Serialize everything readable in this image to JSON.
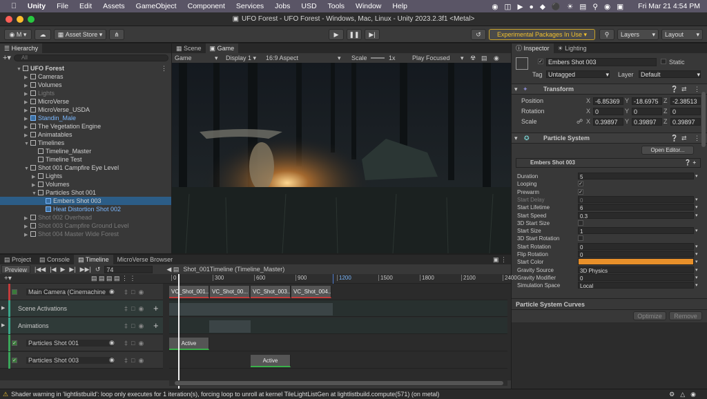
{
  "menubar": {
    "apple": "",
    "app": "Unity",
    "items": [
      "File",
      "Edit",
      "Assets",
      "GameObject",
      "Component",
      "Services",
      "Jobs",
      "USD",
      "Tools",
      "Window",
      "Help"
    ],
    "clock": "Fri Mar 21  4:54 PM"
  },
  "window": {
    "title": "UFO Forest - UFO Forest - Windows, Mac, Linux - Unity 2023.2.3f1 <Metal>"
  },
  "toolbar": {
    "account": "M",
    "asset_store": "Asset Store",
    "experimental": "Experimental Packages In Use",
    "layers": "Layers",
    "layout": "Layout"
  },
  "hierarchy": {
    "tab": "Hierarchy",
    "search_placeholder": "All",
    "items": [
      {
        "label": "UFO Forest",
        "depth": 0,
        "style": "bold"
      },
      {
        "label": "Cameras",
        "depth": 1
      },
      {
        "label": "Volumes",
        "depth": 1
      },
      {
        "label": "Lights",
        "depth": 1,
        "style": "dim"
      },
      {
        "label": "MicroVerse",
        "depth": 1
      },
      {
        "label": "MicroVerse_USDA",
        "depth": 1
      },
      {
        "label": "Standin_Male",
        "depth": 1,
        "style": "blue"
      },
      {
        "label": "The Vegetation Engine",
        "depth": 1
      },
      {
        "label": "Animatables",
        "depth": 1
      },
      {
        "label": "Timelines",
        "depth": 1
      },
      {
        "label": "Timeline_Master",
        "depth": 2
      },
      {
        "label": "Timeline Test",
        "depth": 2
      },
      {
        "label": "Shot 001 Campfire Eye Level",
        "depth": 1
      },
      {
        "label": "Lights",
        "depth": 2
      },
      {
        "label": "Volumes",
        "depth": 2
      },
      {
        "label": "Particles Shot 001",
        "depth": 2
      },
      {
        "label": "Embers Shot 003",
        "depth": 3,
        "style": "selected"
      },
      {
        "label": "Heat Distortion Shot 002",
        "depth": 3,
        "style": "blue"
      },
      {
        "label": "Shot 002 Overhead",
        "depth": 1,
        "style": "dim"
      },
      {
        "label": "Shot 003 Campfire Ground Level",
        "depth": 1,
        "style": "dim"
      },
      {
        "label": "Shot 004 Master Wide Forest",
        "depth": 1,
        "style": "dim"
      }
    ]
  },
  "game_view": {
    "tabs": [
      "Scene",
      "Game"
    ],
    "mode": "Game",
    "display": "Display 1",
    "aspect": "16:9 Aspect",
    "scale_label": "Scale",
    "scale_value": "1x",
    "play_focused": "Play Focused"
  },
  "inspector": {
    "tabs": [
      "Inspector",
      "Lighting"
    ],
    "object_name": "Embers Shot 003",
    "static": "Static",
    "tag_label": "Tag",
    "tag": "Untagged",
    "layer_label": "Layer",
    "layer": "Default",
    "transform": {
      "title": "Transform",
      "rows": [
        {
          "label": "Position",
          "x": "-6.85369",
          "y": "-18.6975",
          "z": "-2.38513"
        },
        {
          "label": "Rotation",
          "x": "0",
          "y": "0",
          "z": "0"
        },
        {
          "label": "Scale",
          "x": "0.39897",
          "y": "0.39897",
          "z": "0.39897"
        }
      ]
    },
    "particle": {
      "title": "Particle System",
      "open_editor": "Open Editor...",
      "module": "Embers Shot 003",
      "rows": [
        {
          "label": "Duration",
          "value": "5"
        },
        {
          "label": "Looping",
          "check": true
        },
        {
          "label": "Prewarm",
          "check": true
        },
        {
          "label": "Start Delay",
          "value": "0",
          "dim": true
        },
        {
          "label": "Start Lifetime",
          "value": "6"
        },
        {
          "label": "Start Speed",
          "value": "0.3"
        },
        {
          "label": "3D Start Size",
          "check": false
        },
        {
          "label": "Start Size",
          "value": "1"
        },
        {
          "label": "3D Start Rotation",
          "check": false
        },
        {
          "label": "Start Rotation",
          "value": "0"
        },
        {
          "label": "Flip Rotation",
          "value": "0"
        },
        {
          "label": "Start Color",
          "color": "#e8902a"
        },
        {
          "label": "Gravity Source",
          "value": "3D Physics"
        },
        {
          "label": "Gravity Modifier",
          "value": "0"
        },
        {
          "label": "Simulation Space",
          "value": "Local"
        }
      ]
    },
    "curves": {
      "title": "Particle System Curves",
      "optimize": "Optimize",
      "remove": "Remove"
    }
  },
  "bottom": {
    "tabs": [
      "Project",
      "Console",
      "Timeline",
      "MicroVerse Browser"
    ],
    "preview": "Preview",
    "frame": "74",
    "timeline_name": "Shot_001Timeline (Timeline_Master)",
    "ruler": [
      "0",
      "300",
      "600",
      "900",
      "1200",
      "1500",
      "1800",
      "2100",
      "2400"
    ],
    "tracks": [
      {
        "label": "Main Camera (Cinemachine"
      },
      {
        "label": "Scene Activations"
      },
      {
        "label": "Animations"
      },
      {
        "label": "Particles Shot 001"
      },
      {
        "label": "Particles Shot 003"
      }
    ],
    "clips": [
      "VC_Shot_001...",
      "VC_Shot_00...",
      "VC_Shot_003...",
      "VC_Shot_004..."
    ],
    "active": "Active"
  },
  "status": {
    "message": "Shader warning in 'lightlistbuild': loop only executes for 1 iteration(s), forcing loop to unroll at kernel TileLightListGen at lightlistbuild.compute(571) (on metal)"
  }
}
